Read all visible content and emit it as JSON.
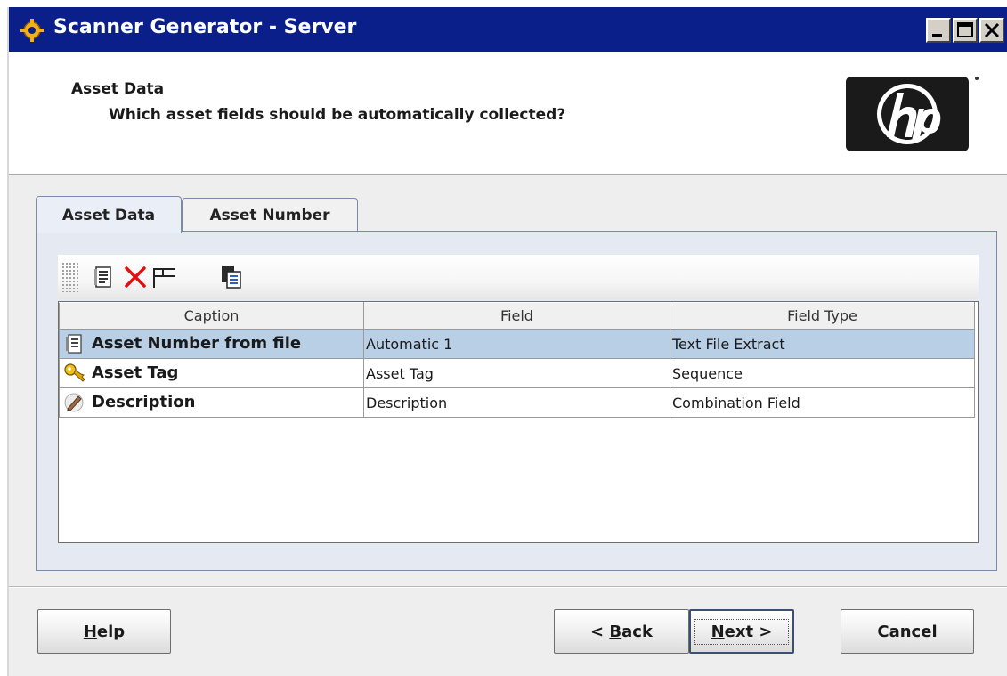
{
  "window": {
    "title": "Scanner Generator - Server"
  },
  "header": {
    "title": "Asset Data",
    "question": "Which asset fields should be automatically collected?"
  },
  "tabs": [
    {
      "label": "Asset Data",
      "selected": true
    },
    {
      "label": "Asset Number",
      "selected": false
    }
  ],
  "toolbar": {
    "buttons": [
      "properties-icon",
      "delete-icon",
      "columns-icon",
      "copy-icon"
    ]
  },
  "table": {
    "columns": [
      "Caption",
      "Field",
      "Field Type"
    ],
    "rows": [
      {
        "caption": "Asset Number from file",
        "field": "Automatic 1",
        "field_type": "Text File Extract",
        "icon": "text-file-icon",
        "selected": true
      },
      {
        "caption": "Asset Tag",
        "field": "Asset Tag",
        "field_type": "Sequence",
        "icon": "key-icon",
        "selected": false
      },
      {
        "caption": "Description",
        "field": "Description",
        "field_type": "Combination Field",
        "icon": "pencil-icon",
        "selected": false
      }
    ]
  },
  "buttons": {
    "help_pre": "",
    "help_mnemonic": "H",
    "help_post": "elp",
    "back_pre": "< ",
    "back_mnemonic": "B",
    "back_post": "ack",
    "next_mnemonic": "N",
    "next_post": "ext >",
    "cancel": "Cancel"
  },
  "colors": {
    "titlebar": "#0a1f8a",
    "selected_row": "#b8cfe5",
    "delete_red": "#e01010"
  }
}
